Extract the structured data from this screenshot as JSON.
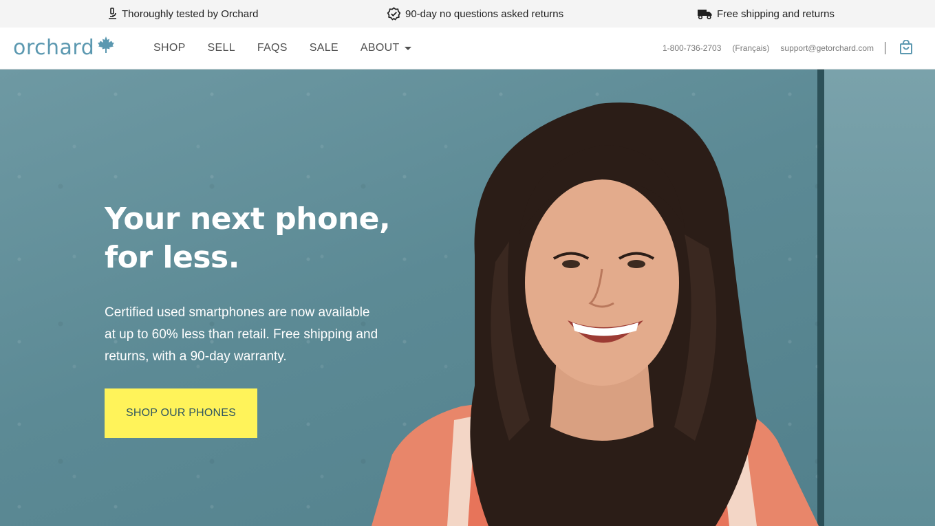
{
  "topbar": {
    "tested": "Thoroughly tested by Orchard",
    "returns": "90-day no questions asked returns",
    "shipping": "Free shipping and returns"
  },
  "header": {
    "logo": "orchard",
    "nav": [
      "SHOP",
      "SELL",
      "FAQS",
      "SALE",
      "ABOUT"
    ],
    "phone": "1-800-736-2703",
    "language": "(Français)",
    "email": "support@getorchard.com"
  },
  "hero": {
    "title_line1": "Your next phone,",
    "title_line2": "for less.",
    "description": "Certified used smartphones are now available at up to 60% less than retail. Free shipping and returns, with a 90-day warranty.",
    "cta": "SHOP OUR PHONES"
  },
  "colors": {
    "brand": "#5b98b0",
    "cta": "#fff35a",
    "hero_bg": "#5c8a95"
  },
  "icons": [
    "microscope-icon",
    "badge-check-icon",
    "truck-icon",
    "maple-leaf-icon",
    "shopping-bag-icon",
    "caret-down-icon"
  ]
}
